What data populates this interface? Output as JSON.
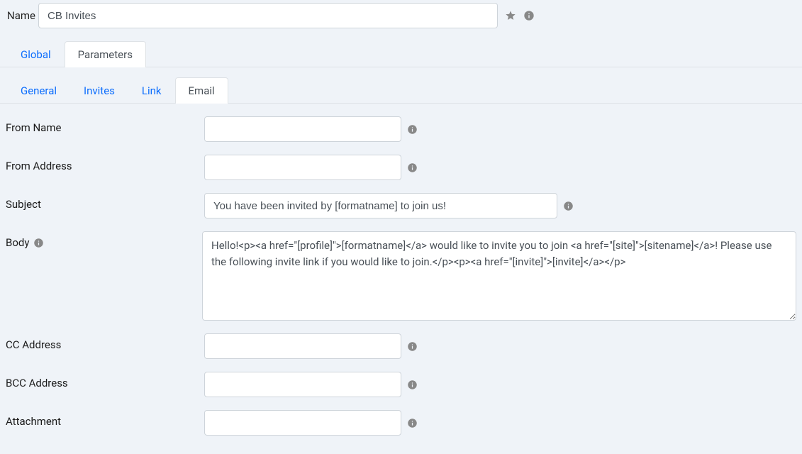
{
  "name_field": {
    "label": "Name",
    "value": "CB Invites"
  },
  "tabs_outer": [
    {
      "label": "Global",
      "active": false
    },
    {
      "label": "Parameters",
      "active": true
    }
  ],
  "tabs_inner": [
    {
      "label": "General",
      "active": false
    },
    {
      "label": "Invites",
      "active": false
    },
    {
      "label": "Link",
      "active": false
    },
    {
      "label": "Email",
      "active": true
    }
  ],
  "form": {
    "from_name": {
      "label": "From Name",
      "value": ""
    },
    "from_address": {
      "label": "From Address",
      "value": ""
    },
    "subject": {
      "label": "Subject",
      "value": "You have been invited by [formatname] to join us!"
    },
    "body": {
      "label": "Body",
      "value": "Hello!<p><a href=\"[profile]\">[formatname]</a> would like to invite you to join <a href=\"[site]\">[sitename]</a>! Please use the following invite link if you would like to join.</p><p><a href=\"[invite]\">[invite]</a></p>"
    },
    "cc_address": {
      "label": "CC Address",
      "value": ""
    },
    "bcc_address": {
      "label": "BCC Address",
      "value": ""
    },
    "attachment": {
      "label": "Attachment",
      "value": ""
    }
  }
}
